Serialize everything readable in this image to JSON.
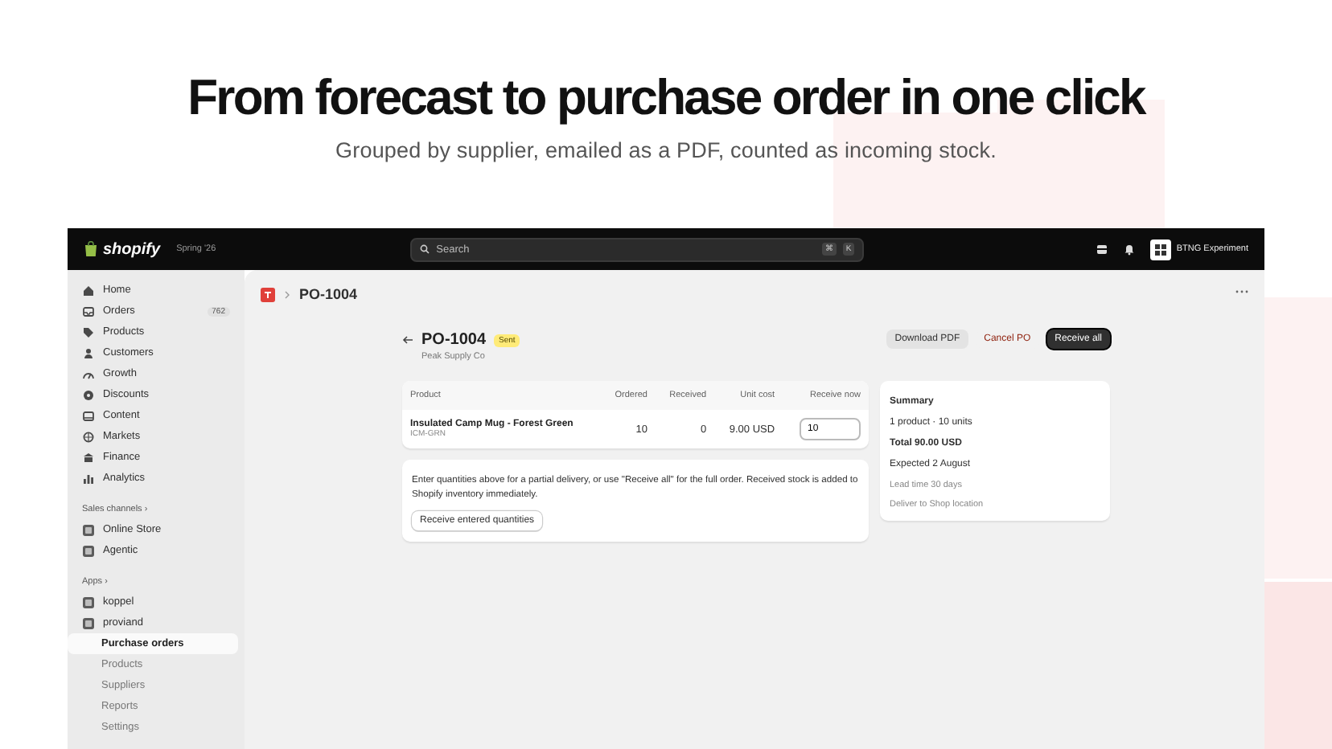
{
  "headline": {
    "title": "From forecast to purchase order in one click",
    "subtitle": "Grouped by supplier, emailed as a PDF, counted as incoming stock."
  },
  "topbar": {
    "brand": "shopify",
    "edition": "Spring '26",
    "search": {
      "placeholder": "Search"
    },
    "shortcut": [
      "⌘",
      "K"
    ],
    "store": "BTNG Experiment"
  },
  "sidebar": {
    "items": [
      {
        "label": "Home"
      },
      {
        "label": "Orders",
        "badge": "762"
      },
      {
        "label": "Products"
      },
      {
        "label": "Customers"
      },
      {
        "label": "Growth"
      },
      {
        "label": "Discounts"
      },
      {
        "label": "Content"
      },
      {
        "label": "Markets"
      },
      {
        "label": "Finance"
      },
      {
        "label": "Analytics"
      }
    ],
    "sections": [
      {
        "title": "Sales channels ›",
        "items": [
          {
            "label": "Online Store"
          },
          {
            "label": "Agentic"
          }
        ]
      },
      {
        "title": "Apps ›",
        "items": [
          {
            "label": "koppel"
          },
          {
            "label": "proviand",
            "children": [
              {
                "label": "Purchase orders",
                "selected": true
              },
              {
                "label": "Products",
                "selected": false
              },
              {
                "label": "Suppliers",
                "selected": false
              },
              {
                "label": "Reports",
                "selected": false
              },
              {
                "label": "Settings",
                "selected": false
              }
            ]
          }
        ]
      }
    ]
  },
  "breadcrumb": "PO-1004",
  "order": {
    "number": "PO-1004",
    "status": "Sent",
    "supplier": "Peak Supply Co",
    "actions": [
      {
        "label": "Download PDF",
        "kind": "secondary"
      },
      {
        "label": "Cancel PO",
        "kind": "danger"
      },
      {
        "label": "Receive all",
        "kind": "primary"
      }
    ],
    "table": {
      "columns": [
        "Product",
        "Ordered",
        "Received",
        "Unit cost",
        "Receive now"
      ],
      "rows": [
        {
          "product": "Insulated Camp Mug - Forest Green",
          "sku": "ICM-GRN",
          "ordered": "10",
          "received": "0",
          "unit_cost": "9.00 USD",
          "receive_now": "10"
        }
      ]
    },
    "note": "Enter quantities above for a partial delivery, or use \"Receive all\" for the full order. Received stock is added to Shopify inventory immediately.",
    "note_button": "Receive entered quantities",
    "summary": {
      "title": "Summary",
      "lines": [
        {
          "text": "1 product · 10 units",
          "kind": "plain"
        },
        {
          "text": "Total 90.00 USD",
          "kind": "strong"
        },
        {
          "text": "Expected 2 August",
          "kind": "plain"
        },
        {
          "text": "Lead time 30 days",
          "kind": "muted"
        },
        {
          "text": "Deliver to Shop location",
          "kind": "muted"
        }
      ]
    }
  }
}
